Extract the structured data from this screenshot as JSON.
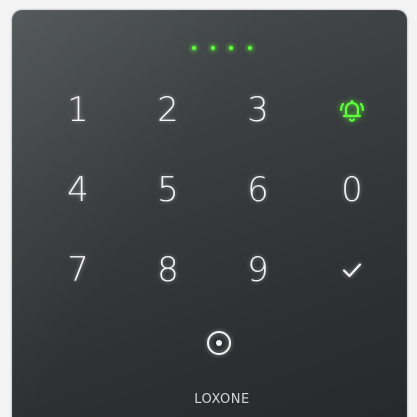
{
  "keypad": {
    "row1": [
      "1",
      "2",
      "3"
    ],
    "row2": [
      "4",
      "5",
      "6",
      "0"
    ],
    "row3": [
      "7",
      "8",
      "9"
    ]
  },
  "icons": {
    "bell": "bell-icon",
    "check": "checkmark-icon",
    "nfc": "nfc-reader-icon"
  },
  "status": {
    "pin_entered_dots": 4
  },
  "brand": {
    "name": "LOXONE"
  },
  "colors": {
    "accent_green": "#5cff3a",
    "key_text": "#f4f4f4",
    "device_body": "#35393b"
  }
}
